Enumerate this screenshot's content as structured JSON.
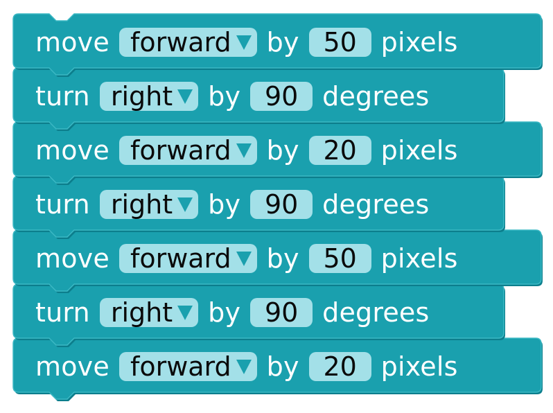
{
  "theme": {
    "block_color": "#1aa0ae",
    "block_shadow": "#0c7e8c",
    "block_highlight": "#3bb8c4",
    "field_color": "#a3e0e8",
    "arrow_color": "#1aa0ae"
  },
  "icons": {
    "dropdown": "triangle-down"
  },
  "blocks": [
    {
      "verb": "move",
      "direction": "forward",
      "by": "by",
      "amount": "50",
      "unit": "pixels"
    },
    {
      "verb": "turn",
      "direction": "right",
      "by": "by",
      "amount": "90",
      "unit": "degrees"
    },
    {
      "verb": "move",
      "direction": "forward",
      "by": "by",
      "amount": "20",
      "unit": "pixels"
    },
    {
      "verb": "turn",
      "direction": "right",
      "by": "by",
      "amount": "90",
      "unit": "degrees"
    },
    {
      "verb": "move",
      "direction": "forward",
      "by": "by",
      "amount": "50",
      "unit": "pixels"
    },
    {
      "verb": "turn",
      "direction": "right",
      "by": "by",
      "amount": "90",
      "unit": "degrees"
    },
    {
      "verb": "move",
      "direction": "forward",
      "by": "by",
      "amount": "20",
      "unit": "pixels"
    }
  ]
}
